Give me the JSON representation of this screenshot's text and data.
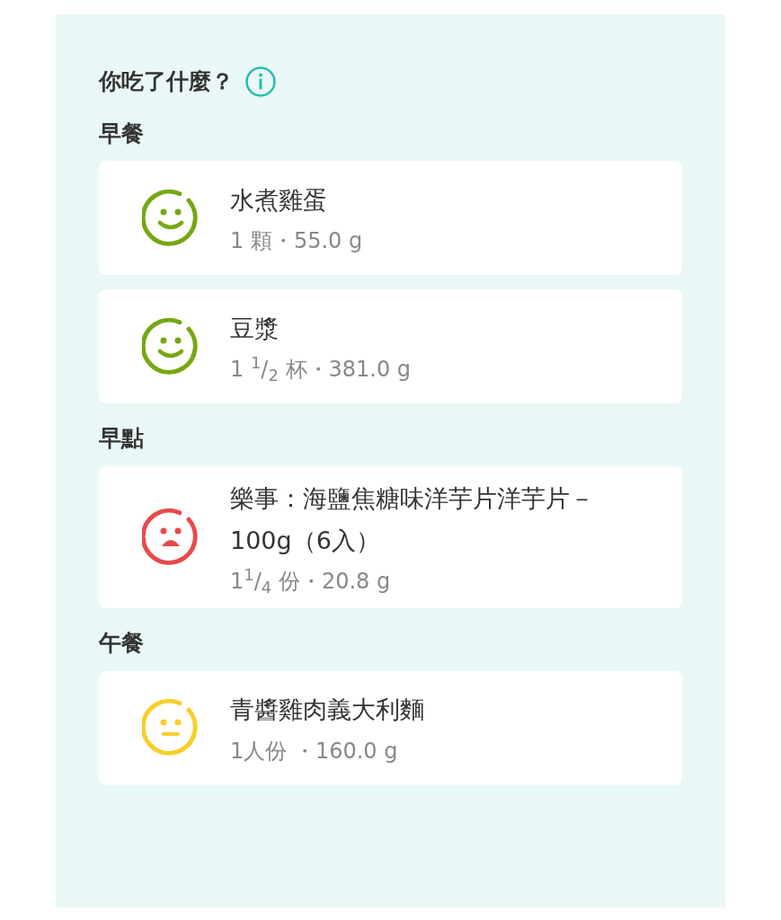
{
  "title": "你吃了什麼？",
  "sections": [
    {
      "heading": "早餐",
      "items": [
        {
          "name": "水煮雞蛋",
          "amount": "1 顆・55.0 g",
          "kind": "happy",
          "color": "#76a712"
        },
        {
          "name": "豆漿",
          "amount": "1 $^{1}$/$_{2}$ 杯・381.0 g",
          "kind": "happy",
          "color": "#76a712"
        }
      ]
    },
    {
      "heading": "早點",
      "items": [
        {
          "name": "樂事：海鹽焦糖味洋芋片洋芋片－100g（6入）",
          "amount": "1$^{1}$/$_{4}$ 份・20.8 g",
          "kind": "sad",
          "color": "#e84a4a"
        }
      ]
    },
    {
      "heading": "午餐",
      "items": [
        {
          "name": "青醬雞肉義大利麵",
          "amount": "1人份 ・160.0 g",
          "kind": "neutral",
          "color": "#f7cf2a"
        }
      ]
    }
  ]
}
